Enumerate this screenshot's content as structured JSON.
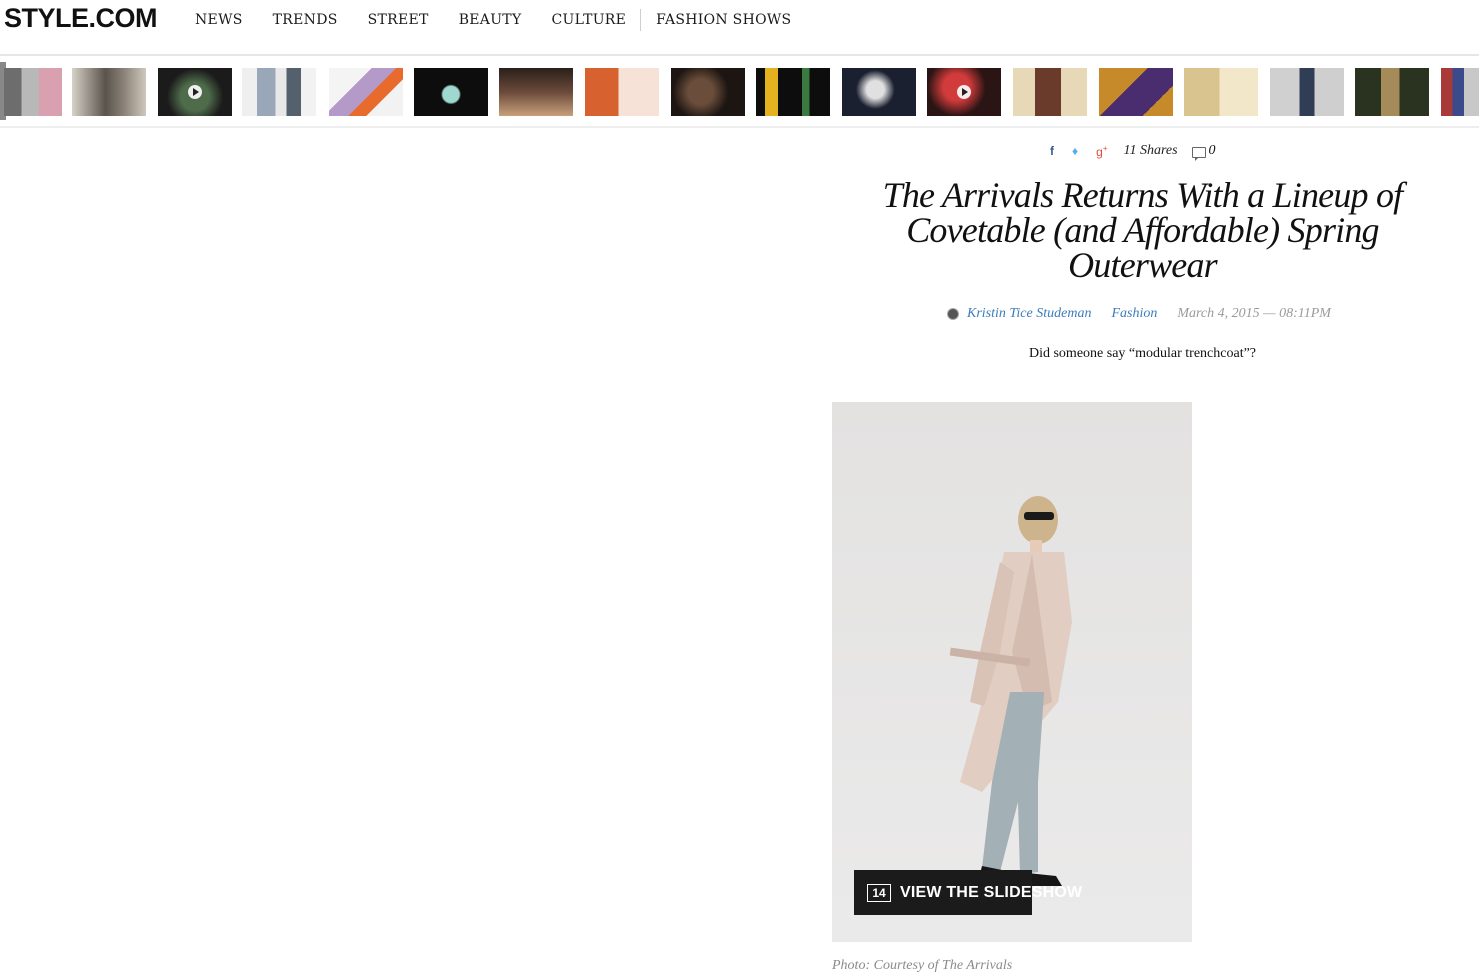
{
  "header": {
    "logo": "STYLE.COM",
    "nav": [
      "NEWS",
      "TRENDS",
      "STREET",
      "BEAUTY",
      "CULTURE",
      "FASHION SHOWS"
    ]
  },
  "article": {
    "social": {
      "facebook_icon": "facebook-icon",
      "twitter_icon": "twitter-icon",
      "gplus_icon": "google-plus-icon",
      "shares_label": "11 Shares",
      "comment_count": "0"
    },
    "title": "The Arrivals Returns With a Lineup of Covetable (and Affordable) Spring Outerwear",
    "author": "Kristin Tice Studeman",
    "category": "Fashion",
    "date": "March 4, 2015 — 08:11PM",
    "dek": "Did someone say “modular trenchcoat”?",
    "slideshow_count": "14",
    "slideshow_label": "VIEW THE SLIDESHOW",
    "photo_credit": "Photo: Courtesy of The Arrivals"
  },
  "colors": {
    "link": "#3b7dbb",
    "meta": "#9a9a9a",
    "facebook": "#3b5998",
    "twitter": "#55acee",
    "gplus": "#dd4b39"
  }
}
